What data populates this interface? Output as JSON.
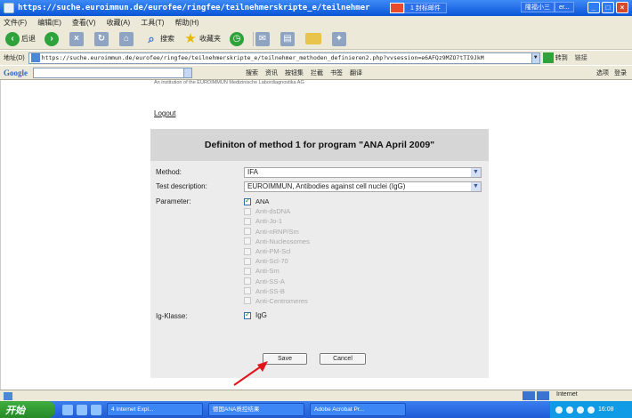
{
  "window": {
    "title": "https://suche.euroimmun.de/eurofee/ringfee/teilnehmerskripte_e/teilnehmer",
    "ext_segment": "1 封标邮件",
    "ext_segment2": "隆福小三",
    "ext_segment3": "er..."
  },
  "menu": [
    "文件(F)",
    "编辑(E)",
    "查看(V)",
    "收藏(A)",
    "工具(T)",
    "帮助(H)"
  ],
  "toolbar": {
    "back": "后退",
    "search": "搜索",
    "favorites": "收藏夹"
  },
  "address": {
    "label": "地址(D)",
    "url": "https://suche.euroimmun.de/eurofee/ringfee/teilnehmerskripte_e/teilnehmer_methoden_definieren2.php?vvsession=e6AFQz9MZO7tTI9JkM",
    "go": "转到",
    "links": "链接"
  },
  "google": {
    "logo": "Google",
    "items": [
      "搜索",
      "资讯",
      "按钮集",
      "拦截",
      "书签",
      "翻译"
    ],
    "right": [
      "选项",
      "登录"
    ]
  },
  "page": {
    "institution": "An institution of the EUROIMMUN Medizinische Labordiagnostika AG",
    "logout": "Logout",
    "form_title": "Definiton of method 1 for program \"ANA April 2009\"",
    "method_label": "Method:",
    "method_value": "IFA",
    "test_label": "Test description:",
    "test_value": "EUROIMMUN, Antibodies against cell nuclei (IgG)",
    "parameter_label": "Parameter:",
    "parameters": [
      {
        "label": "ANA",
        "checked": true,
        "enabled": true
      },
      {
        "label": "Anti-dsDNA",
        "checked": false,
        "enabled": false
      },
      {
        "label": "Anti-Jo-1",
        "checked": false,
        "enabled": false
      },
      {
        "label": "Anti-nRNP/Sm",
        "checked": false,
        "enabled": false
      },
      {
        "label": "Anti-Nucleosomes",
        "checked": false,
        "enabled": false
      },
      {
        "label": "Anti-PM-Scl",
        "checked": false,
        "enabled": false
      },
      {
        "label": "Anti-Scl-70",
        "checked": false,
        "enabled": false
      },
      {
        "label": "Anti-Sm",
        "checked": false,
        "enabled": false
      },
      {
        "label": "Anti-SS-A",
        "checked": false,
        "enabled": false
      },
      {
        "label": "Anti-SS-B",
        "checked": false,
        "enabled": false
      },
      {
        "label": "Anti-Centromeres",
        "checked": false,
        "enabled": false
      }
    ],
    "ig_label": "Ig-Klasse:",
    "ig_value": "IgG",
    "save": "Save",
    "cancel": "Cancel"
  },
  "status": {
    "zone": "Internet"
  },
  "taskbar": {
    "start": "开始",
    "tasks": [
      "4 Internet Expl...",
      "德国ANA质控结果",
      "Adobe Acrobat Pr..."
    ],
    "clock": "16:08"
  },
  "colors": {
    "form_bg": "#ececec",
    "form_header": "#d6d6d6",
    "annotation_arrow": "#e0141a"
  }
}
